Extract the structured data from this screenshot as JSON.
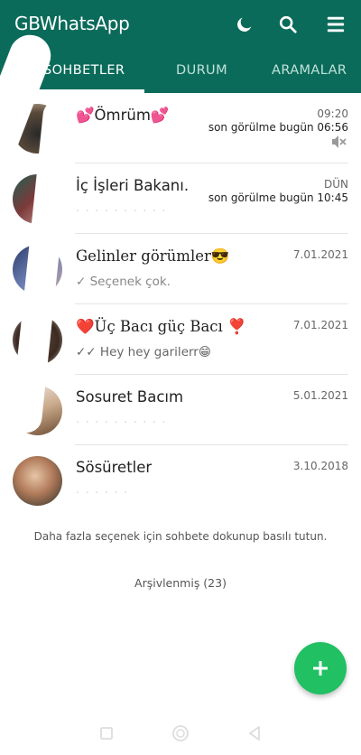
{
  "app": {
    "title": "GBWhatsApp"
  },
  "tabs": [
    {
      "label": "SOHBETLER"
    },
    {
      "label": "DURUM"
    },
    {
      "label": "ARAMALAR"
    }
  ],
  "chats": [
    {
      "name": "💕Ömrüm💕",
      "time": "09:20",
      "status": "son görülme bugün 06:56",
      "preview": "",
      "muted": true
    },
    {
      "name": "İç İşleri Bakanı.",
      "time": "DÜN",
      "status": "son görülme bugün 10:45",
      "preview": ""
    },
    {
      "name": "Gelinler görümler😎",
      "time": "7.01.2021",
      "preview": "✓ Seçenek çok."
    },
    {
      "name": "❤️Üç Bacı güç Bacı ❣️",
      "time": "7.01.2021",
      "preview": "✓✓ Hey hey garilerr😁"
    },
    {
      "name": "Sosuret Bacım",
      "time": "5.01.2021",
      "preview": ""
    },
    {
      "name": "Sösüretler",
      "time": "3.10.2018",
      "preview": ""
    }
  ],
  "footer": {
    "hint": "Daha fazla seçenek için sohbete dokunup basılı tutun.",
    "archived": "Arşivlenmiş (23)"
  },
  "colors": {
    "header": "#0b6b5a",
    "fab": "#21c063",
    "read_tick": "#4a7fd6"
  }
}
